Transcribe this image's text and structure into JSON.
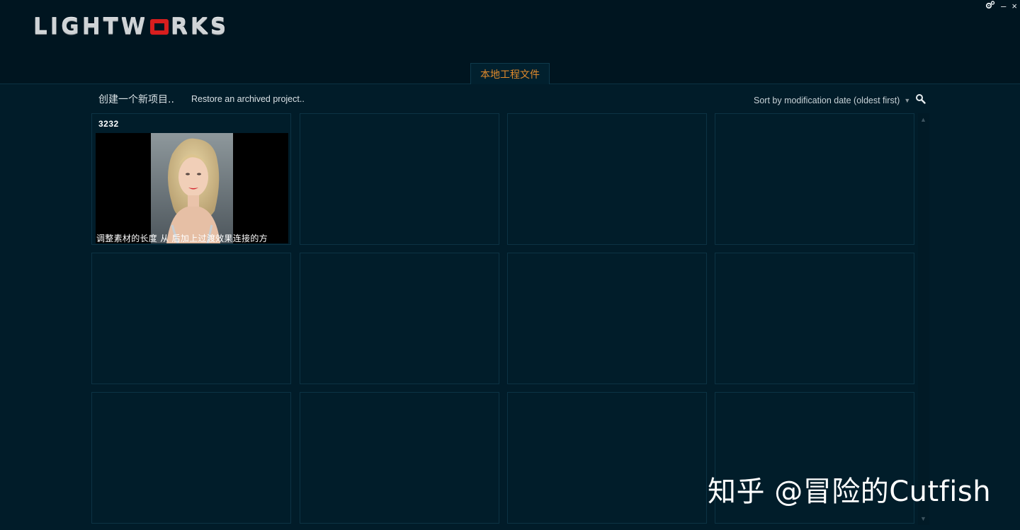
{
  "app": {
    "logo_text_left": "LIGHTW",
    "logo_text_right": "RKS",
    "brand_color": "#d81e1e"
  },
  "window_controls": {
    "settings_icon": "gear-icon",
    "minimize_label": "–",
    "close_label": "×"
  },
  "tabs": [
    {
      "label": "本地工程文件",
      "active": true,
      "color": "#e28a2c"
    }
  ],
  "toolbar": {
    "create_label": "创建一个新项目..",
    "restore_label": "Restore an archived project..",
    "sort_label": "Sort by modification date (oldest first)",
    "sort_arrow": "▼",
    "search_icon": "search-icon"
  },
  "projects": [
    {
      "title": "3232",
      "caption": "调整素材的长度 从 后加上过渡效果连接的方",
      "has_thumbnail": true
    }
  ],
  "scrollbar": {
    "up_arrow": "▲",
    "down_arrow": "▼"
  },
  "watermark": {
    "text": "知乎 @冒险的Cutfish"
  }
}
